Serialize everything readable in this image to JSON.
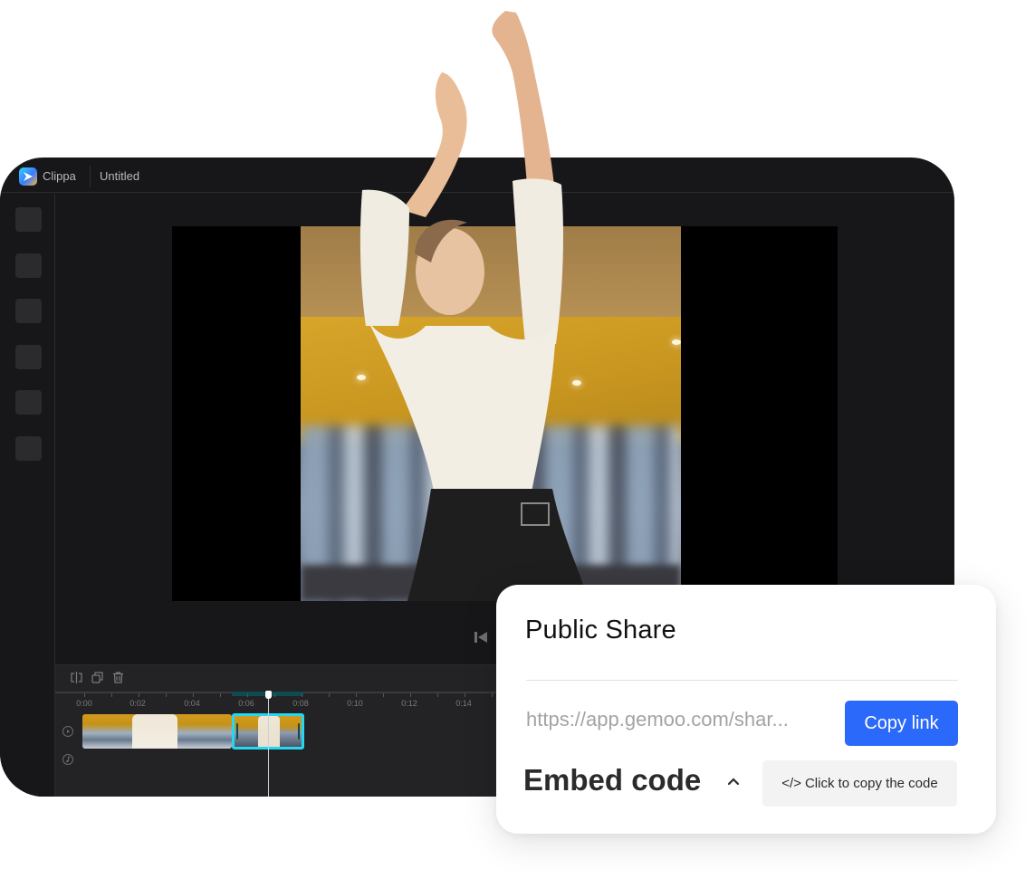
{
  "window": {
    "app_name": "Clippa",
    "document_title": "Untitled",
    "brand_colors": {
      "logo_gradient": [
        "#2fd2ff",
        "#3a7bff",
        "#f6b73c"
      ],
      "window_bg": "#17171a",
      "timeline_bg": "#232326",
      "clip_selected_border": "#25d8f2",
      "range_highlight": "#0f4a4e"
    }
  },
  "sidebar": {
    "items": [
      {
        "icon": "tool-slot-1"
      },
      {
        "icon": "tool-slot-2"
      },
      {
        "icon": "tool-slot-3"
      },
      {
        "icon": "tool-slot-4"
      },
      {
        "icon": "tool-slot-5"
      },
      {
        "icon": "tool-slot-6"
      }
    ]
  },
  "player": {
    "controls": [
      {
        "icon": "skip-to-start-icon"
      }
    ]
  },
  "timeline": {
    "tools": [
      {
        "icon": "split-icon"
      },
      {
        "icon": "duplicate-icon"
      },
      {
        "icon": "delete-icon"
      }
    ],
    "ruler_labels": [
      "0:00",
      "0:02",
      "0:04",
      "0:06",
      "0:08",
      "0:10",
      "0:12",
      "0:14"
    ],
    "tracks": [
      {
        "icon": "video-track-icon"
      },
      {
        "icon": "audio-track-icon"
      }
    ],
    "playhead_time": "0:07"
  },
  "share_card": {
    "title": "Public Share",
    "url": "https://app.gemoo.com/shar...",
    "copy_link_label": "Copy link",
    "embed_label": "Embed code",
    "embed_expanded": true,
    "copy_code_icon": "</>",
    "copy_code_label": "Click to copy the code",
    "accent_color": "#2b69fb"
  }
}
